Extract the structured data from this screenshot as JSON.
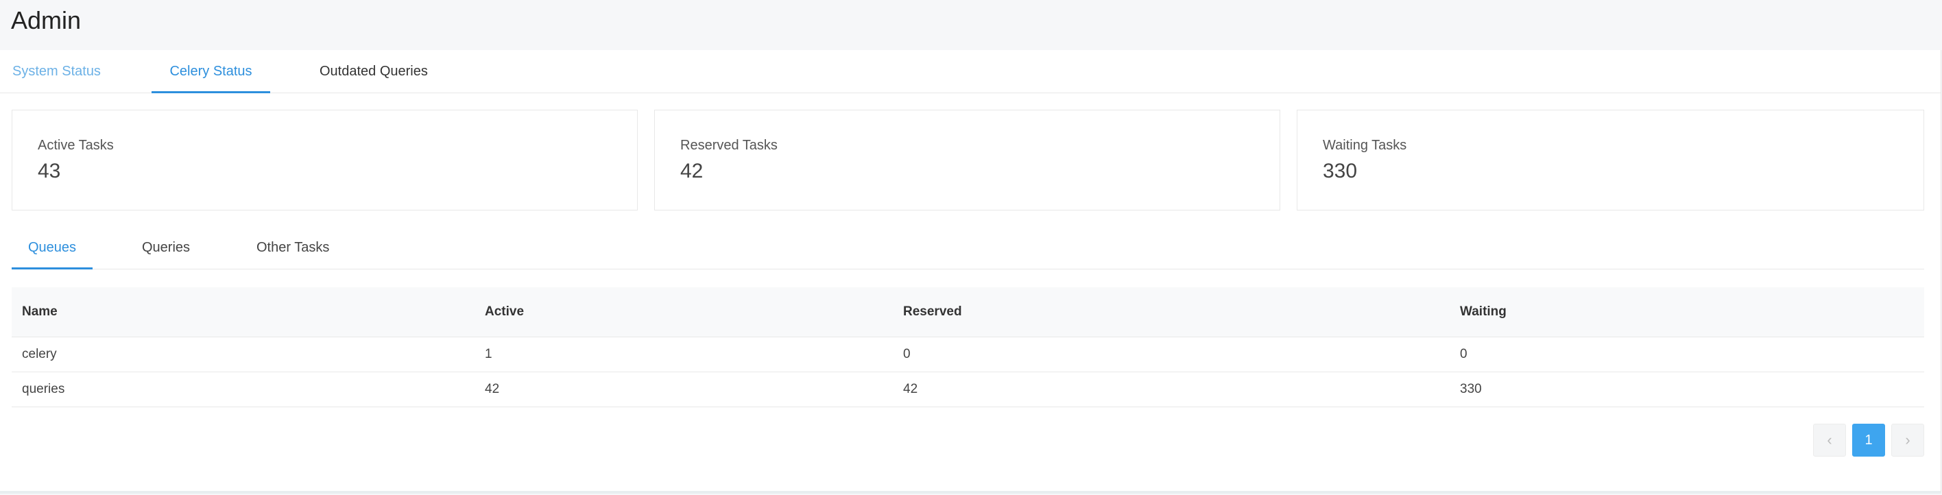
{
  "page": {
    "title": "Admin"
  },
  "top_tabs": [
    {
      "label": "System Status"
    },
    {
      "label": "Celery Status"
    },
    {
      "label": "Outdated Queries"
    }
  ],
  "active_top_tab": "Celery Status",
  "stats": {
    "active": {
      "label": "Active Tasks",
      "value": "43"
    },
    "reserved": {
      "label": "Reserved Tasks",
      "value": "42"
    },
    "waiting": {
      "label": "Waiting Tasks",
      "value": "330"
    }
  },
  "sub_tabs": [
    {
      "label": "Queues"
    },
    {
      "label": "Queries"
    },
    {
      "label": "Other Tasks"
    }
  ],
  "active_sub_tab": "Queues",
  "table": {
    "headers": [
      "Name",
      "Active",
      "Reserved",
      "Waiting"
    ],
    "rows": [
      [
        "celery",
        "1",
        "0",
        "0"
      ],
      [
        "queries",
        "42",
        "42",
        "330"
      ]
    ]
  },
  "pagination": {
    "prev_icon": "‹",
    "current_page": "1",
    "next_icon": "›"
  },
  "colors": {
    "accent": "#2d8fdd",
    "accent_light": "#6cb1e6",
    "page_button": "#3ea5ef"
  }
}
